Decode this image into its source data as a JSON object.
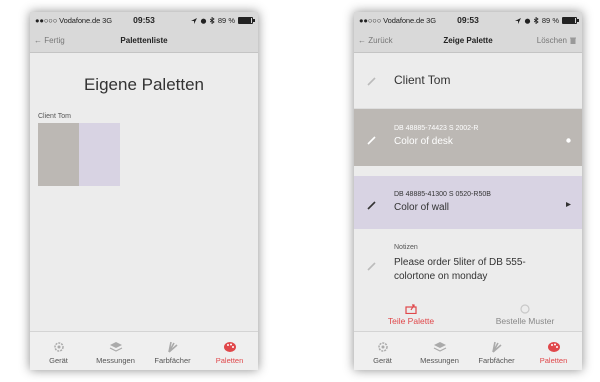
{
  "status": {
    "carrier": "●●○○○ Vodafone.de  3G",
    "time": "09:53",
    "battery": "89 %",
    "battery_level": 0.89
  },
  "left": {
    "nav": {
      "back": "Fertig",
      "title": "Palettenliste"
    },
    "heading": "Eigene Paletten",
    "palette": {
      "name": "Client Tom",
      "swatches": [
        "#bcb8b4",
        "#d8d3e3"
      ]
    }
  },
  "right": {
    "nav": {
      "back": "Zurück",
      "title": "Zeige Palette",
      "action": "Löschen"
    },
    "palette_title": "Client Tom",
    "colors": [
      {
        "code": "DB 48885-74423 S 2002-R",
        "name": "Color of desk",
        "bg": "#bcb8b4",
        "fg": "#ffffff"
      },
      {
        "code": "DB 48885-41300 S 0520-R50B",
        "name": "Color of wall",
        "bg": "#d8d3e3",
        "fg": "#333333"
      }
    ],
    "notes": {
      "label": "Notizen",
      "text": "Please order 5liter of DB 555-colortone on monday"
    },
    "actions": {
      "share": "Teile Palette",
      "order": "Bestelle Muster"
    }
  },
  "tabs": [
    {
      "label": "Gerät",
      "icon": "gear-icon"
    },
    {
      "label": "Messungen",
      "icon": "layers-icon"
    },
    {
      "label": "Farbfächer",
      "icon": "fan-icon"
    },
    {
      "label": "Paletten",
      "icon": "palette-icon",
      "active": true
    }
  ],
  "colors": {
    "accent": "#e0474a",
    "bar": "#d9d9d9",
    "tabbar": "#efefef"
  }
}
